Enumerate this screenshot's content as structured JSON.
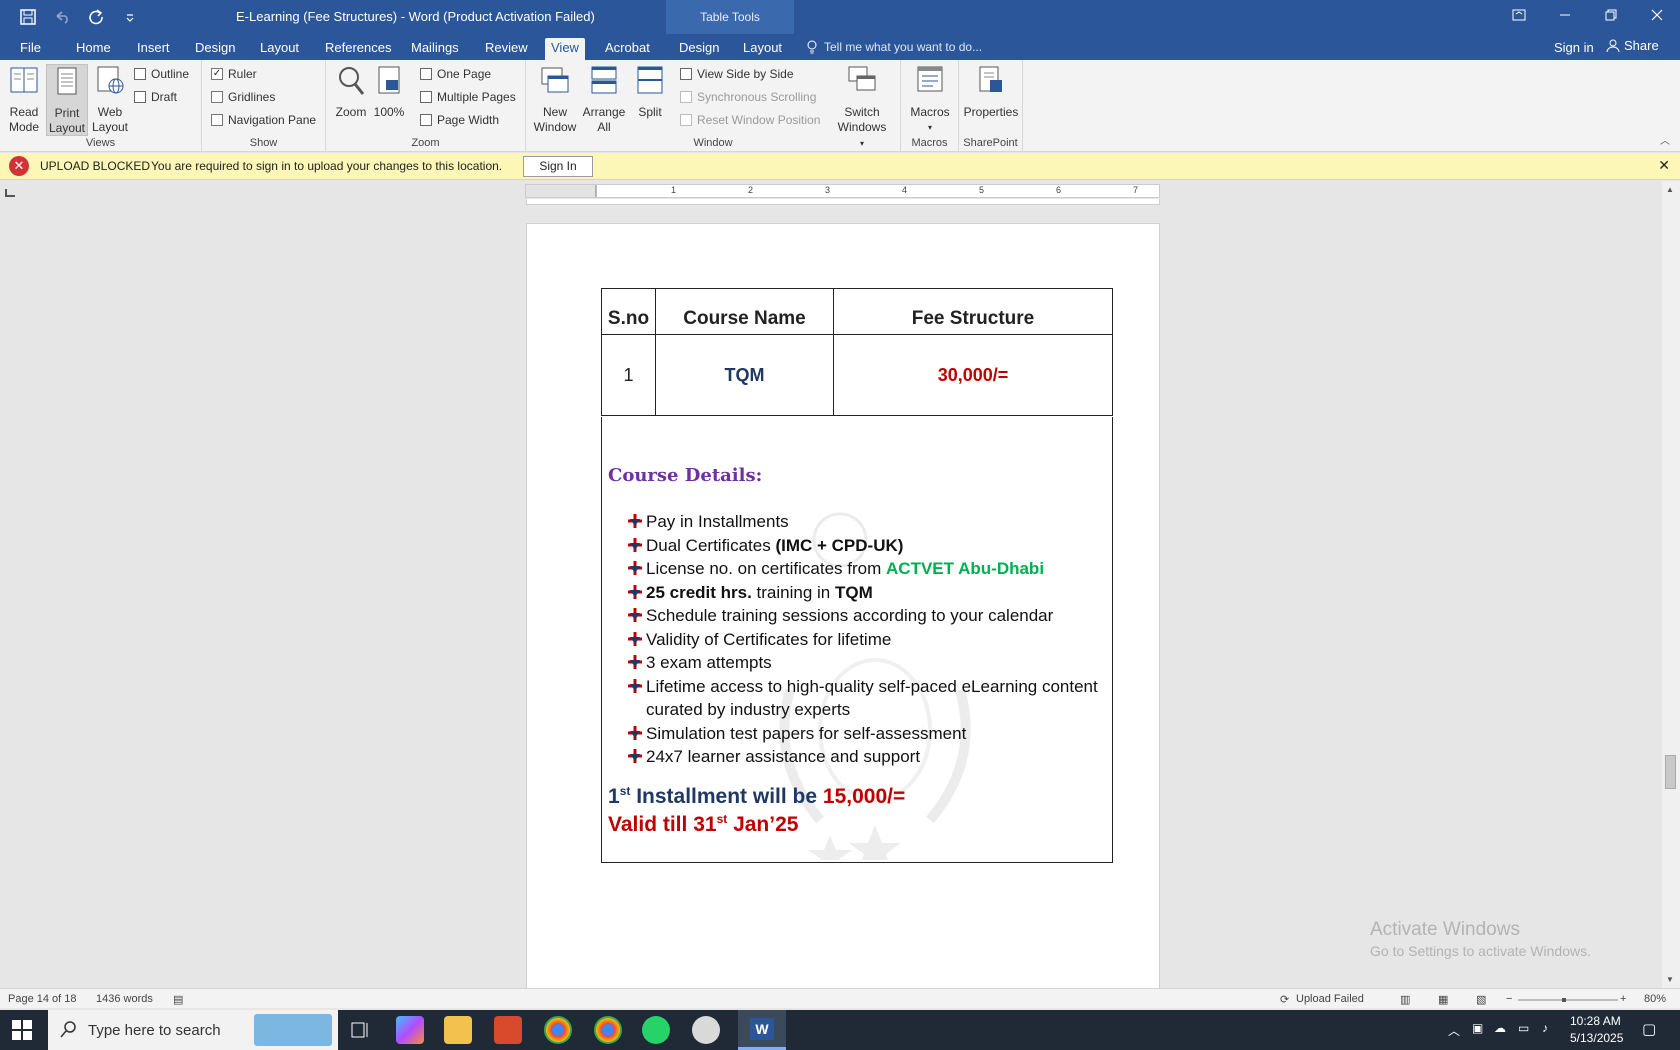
{
  "window": {
    "title": "E-Learning (Fee Structures) - Word (Product Activation Failed)",
    "contextual_tab_title": "Table Tools"
  },
  "tabs": [
    "File",
    "Home",
    "Insert",
    "Design",
    "Layout",
    "References",
    "Mailings",
    "Review",
    "View",
    "Acrobat",
    "Design",
    "Layout"
  ],
  "active_tab": "View",
  "tell_me": "Tell me what you want to do...",
  "sign_in": "Sign in",
  "share": "Share",
  "ribbon": {
    "views": {
      "read_mode_1": "Read",
      "read_mode_2": "Mode",
      "print_layout_1": "Print",
      "print_layout_2": "Layout",
      "web_layout_1": "Web",
      "web_layout_2": "Layout",
      "outline": "Outline",
      "draft": "Draft",
      "label": "Views"
    },
    "show": {
      "ruler": "Ruler",
      "gridlines": "Gridlines",
      "navigation_pane": "Navigation Pane",
      "label": "Show"
    },
    "zoom": {
      "zoom": "Zoom",
      "hundred": "100%",
      "one_page": "One Page",
      "multiple_pages": "Multiple Pages",
      "page_width": "Page Width",
      "label": "Zoom"
    },
    "window": {
      "new_window_1": "New",
      "new_window_2": "Window",
      "arrange_all_1": "Arrange",
      "arrange_all_2": "All",
      "split": "Split",
      "view_side_by_side": "View Side by Side",
      "synchronous_scrolling": "Synchronous Scrolling",
      "reset_window_position": "Reset Window Position",
      "switch_windows_1": "Switch",
      "switch_windows_2": "Windows",
      "label": "Window"
    },
    "macros": {
      "macros": "Macros",
      "label": "Macros"
    },
    "sharepoint": {
      "properties": "Properties",
      "label": "SharePoint"
    }
  },
  "message_bar": {
    "title": "UPLOAD BLOCKED",
    "text": "You are required to sign in to upload your changes to this location.",
    "button": "Sign In"
  },
  "ruler_numbers": [
    "1",
    "2",
    "3",
    "4",
    "5",
    "6",
    "7"
  ],
  "document": {
    "table": {
      "headers": [
        "S.no",
        "Course Name",
        "Fee Structure"
      ],
      "row": [
        "1",
        "TQM",
        "30,000/="
      ]
    },
    "details_title": "Course Details:",
    "bullets": {
      "b1": "Pay in Installments",
      "b2a": "Dual Certificates ",
      "b2b": "(IMC + CPD-UK)",
      "b3a": "License no. on certificates from ",
      "b3b": "ACTVET Abu-Dhabi",
      "b4a": "25 credit hrs.",
      "b4b": " training in ",
      "b4c": "TQM",
      "b5": "Schedule training sessions according to your calendar",
      "b6": "Validity of Certificates for lifetime",
      "b7": "3 exam attempts",
      "b8": "Lifetime access to high-quality self-paced eLearning content curated by industry experts",
      "b9": "Simulation test papers for self-assessment",
      "b10": "24x7 learner assistance and support"
    },
    "installment": {
      "n": "1",
      "sup": "st",
      "text": " Installment will be ",
      "amount": "15,000/="
    },
    "valid": {
      "text": "Valid till 31",
      "sup": "st",
      "tail": " Jan’25"
    }
  },
  "watermark_activation": {
    "line1": "Activate Windows",
    "line2": "Go to Settings to activate Windows."
  },
  "status": {
    "page": "Page 14 of 18",
    "words": "1436 words",
    "upload": "Upload Failed",
    "zoom": "80%"
  },
  "taskbar": {
    "search_placeholder": "Type here to search",
    "time": "10:28 AM",
    "date": "5/13/2025"
  }
}
